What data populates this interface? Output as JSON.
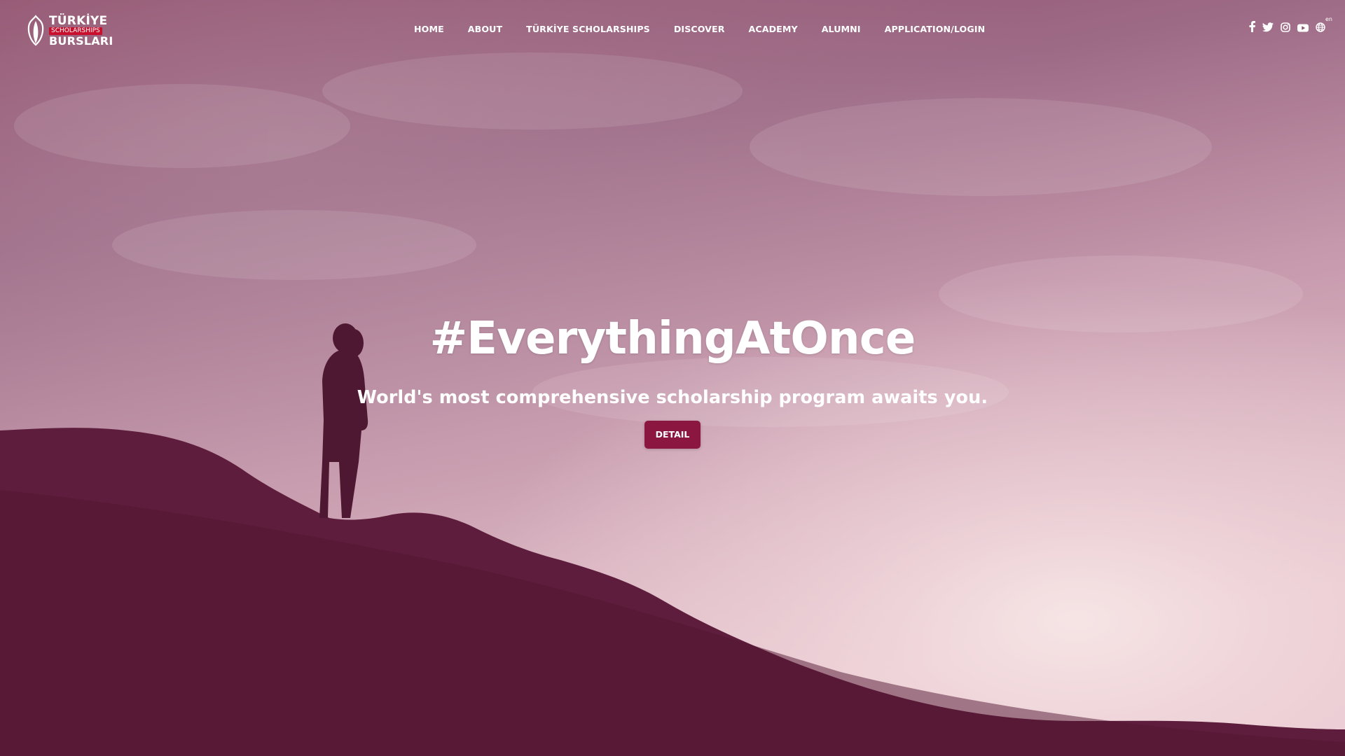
{
  "brand": {
    "line1": "TÜRKİYE",
    "line2": "SCHOLARSHIPS",
    "line3": "BURSLARI",
    "accent_color": "#c8102e"
  },
  "nav": {
    "items": [
      {
        "label": "HOME"
      },
      {
        "label": "ABOUT"
      },
      {
        "label": "TÜRKİYE SCHOLARSHIPS"
      },
      {
        "label": "DISCOVER"
      },
      {
        "label": "ACADEMY"
      },
      {
        "label": "ALUMNI"
      },
      {
        "label": "APPLICATION/LOGIN"
      }
    ]
  },
  "social": {
    "icons": [
      "facebook-icon",
      "twitter-icon",
      "instagram-icon",
      "youtube-icon",
      "globe-icon"
    ],
    "language_code": "en"
  },
  "hero": {
    "title": "#EverythingAtOnce",
    "subtitle": "World's most comprehensive scholarship program awaits you.",
    "button_label": "DETAIL",
    "button_color": "#8b1740"
  }
}
